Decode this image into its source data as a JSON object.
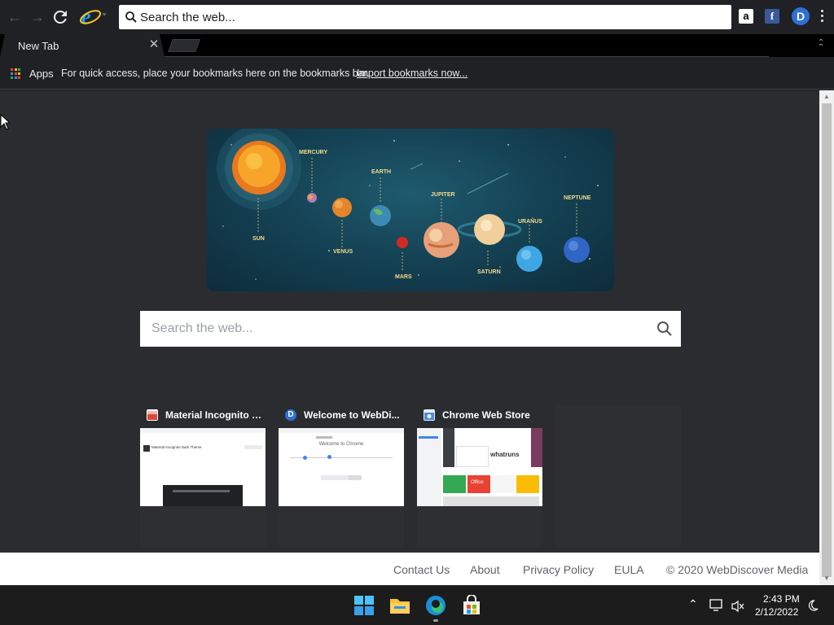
{
  "browser": {
    "omnibox_placeholder": "Search the web...",
    "tab_title": "New Tab",
    "extensions": {
      "amazon": "a",
      "facebook": "f",
      "webdiscover": "D"
    }
  },
  "bookmarks_bar": {
    "apps_label": "Apps",
    "hint": "For quick access, place your bookmarks here on the bookmarks bar.",
    "import_link": "Import bookmarks now..."
  },
  "hero": {
    "planets": [
      "MERCURY",
      "EARTH",
      "JUPITER",
      "URANUS",
      "NEPTUNE",
      "SUN",
      "VENUS",
      "MARS",
      "SATURN"
    ]
  },
  "search": {
    "placeholder": "Search the web..."
  },
  "tiles": [
    {
      "title": "Material Incognito D...",
      "favicon_color": "#d44b3c"
    },
    {
      "title": "Welcome to WebDi...",
      "favicon_color": "#2f6fd6"
    },
    {
      "title": "Chrome Web Store",
      "favicon_color": "#4a8fd9"
    }
  ],
  "thumb_text": {
    "tile1_heading": "Material Incognito Dark Theme",
    "tile2_heading": "Welcome to Chrome",
    "tile3_brand": "whatruns",
    "tile3_office": "Office"
  },
  "footer": {
    "contact": "Contact Us",
    "about": "About",
    "privacy": "Privacy Policy",
    "eula": "EULA",
    "copyright": "© 2020 WebDiscover Media"
  },
  "taskbar": {
    "time": "2:43 PM",
    "date": "2/12/2022",
    "icons": [
      "windows-start-icon",
      "file-explorer-icon",
      "edge-icon",
      "store-icon"
    ]
  }
}
